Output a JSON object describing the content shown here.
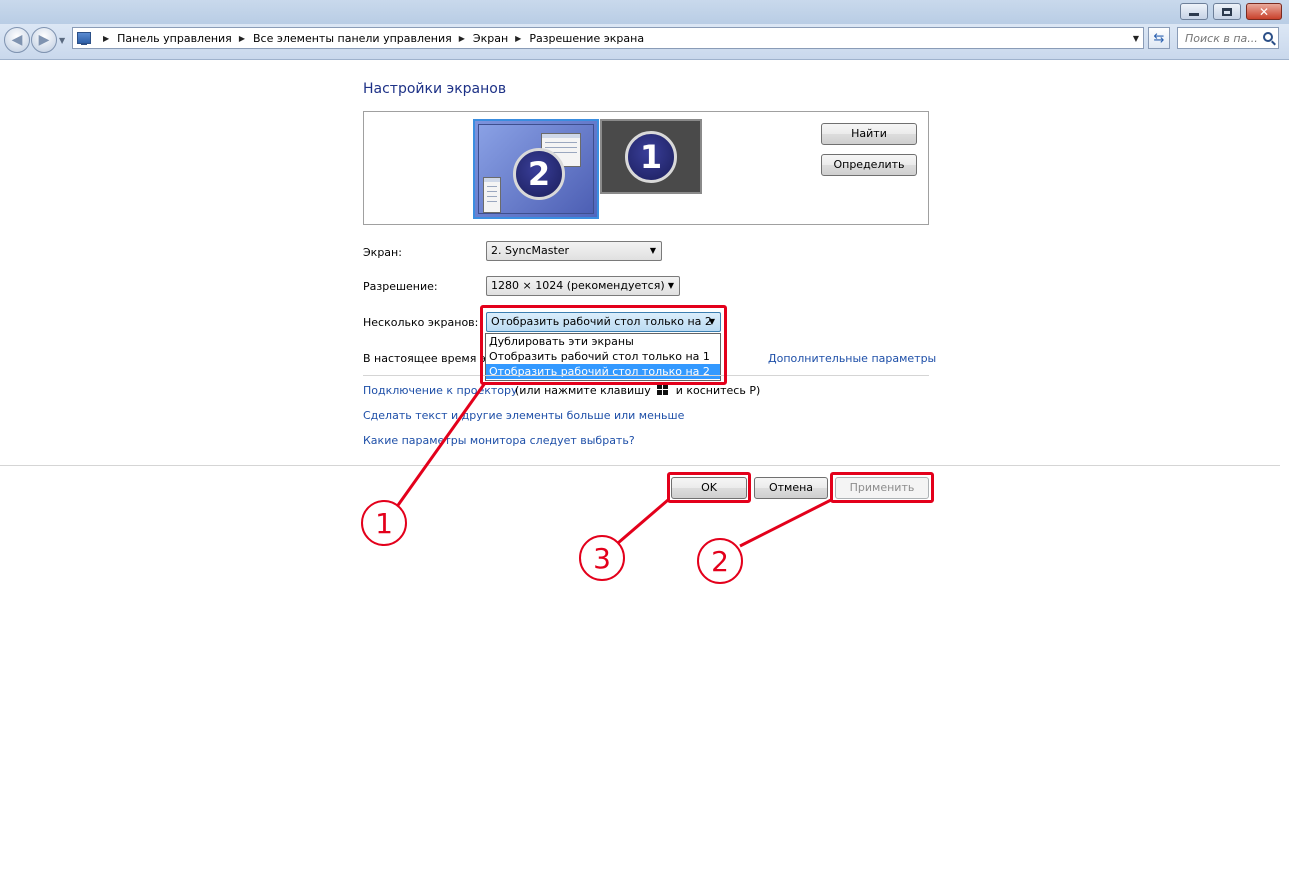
{
  "titlebar": {
    "buttons": [
      "minimize-icon",
      "maximize-icon",
      "close-icon"
    ]
  },
  "navigation": {
    "back_icon": "back-arrow-icon",
    "forward_icon": "forward-arrow-icon",
    "breadcrumbs": [
      "Панель управления",
      "Все элементы панели управления",
      "Экран",
      "Разрешение экрана"
    ],
    "search_placeholder": "Поиск в па..."
  },
  "main": {
    "title": "Настройки экранов",
    "monitor_preview": {
      "monitors": [
        {
          "number": "2",
          "selected": true
        },
        {
          "number": "1",
          "selected": false
        }
      ],
      "find_button": "Найти",
      "identify_button": "Определить"
    },
    "fields": {
      "screen_label": "Экран:",
      "screen_value": "2. SyncMaster",
      "resolution_label": "Разрешение:",
      "resolution_value": "1280 × 1024 (рекомендуется)",
      "multi_label": "Несколько экранов:",
      "multi_value": "Отобразить рабочий стол только на 2",
      "multi_options": [
        "Дублировать эти экраны",
        "Отобразить рабочий стол только на 1",
        "Отобразить рабочий стол только на 2"
      ],
      "multi_selected_index": 2
    },
    "current_text": "В настоящее время эт",
    "advanced_link": "Дополнительные параметры",
    "links": {
      "projector_link": "Подключение к проектору",
      "projector_hint_pre": "(или нажмите клавишу",
      "projector_hint_post": "и коснитесь P)",
      "text_size_link": "Сделать текст и другие элементы больше или меньше",
      "monitor_help_link": "Какие параметры монитора следует выбрать?"
    }
  },
  "footer": {
    "ok_button": "OK",
    "cancel_button": "Отмена",
    "apply_button": "Применить"
  },
  "annotations": {
    "color": "#e3001b",
    "steps": [
      "1",
      "2",
      "3"
    ]
  }
}
